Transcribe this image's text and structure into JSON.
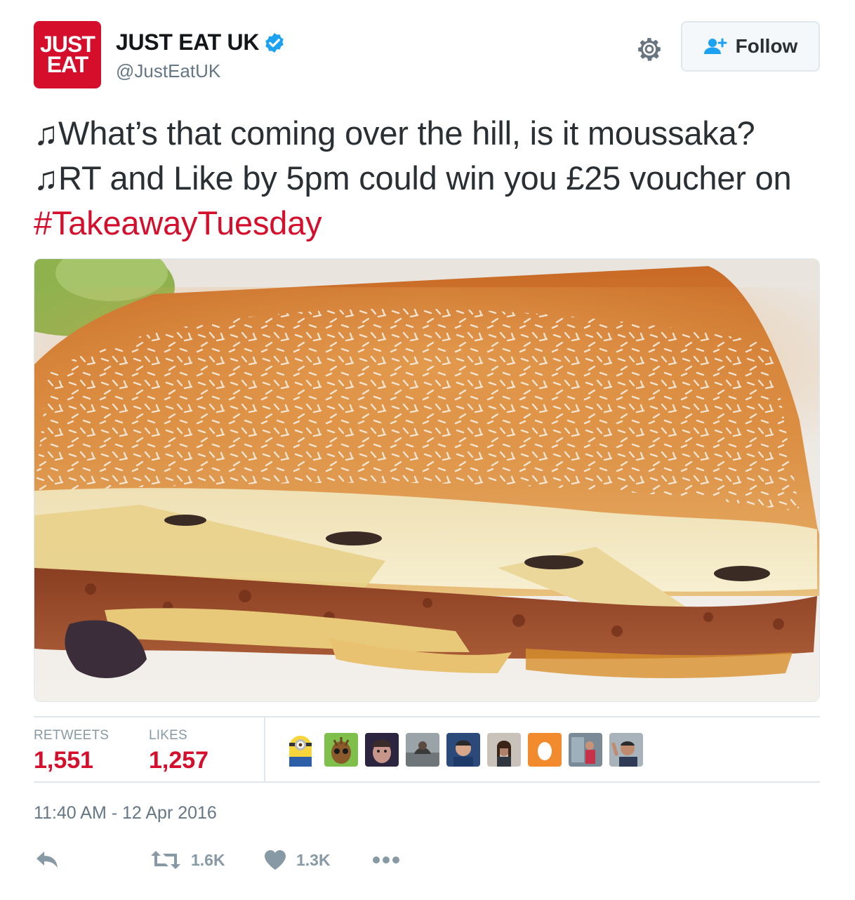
{
  "account": {
    "logo_line1": "JUST",
    "logo_line2": "EAT",
    "display_name": "JUST EAT UK",
    "handle": "@JustEatUK",
    "brand_color": "#d50e2c",
    "verified_color": "#1da1f2"
  },
  "header": {
    "settings_icon": "gear-icon",
    "follow_label": "Follow",
    "follow_icon": "add-person-icon"
  },
  "tweet": {
    "text_part1": "♫What’s that coming over the hill, is it moussaka? ♫RT and Like by 5pm could win you £25 voucher on ",
    "hashtag": "#TakeawayTuesday"
  },
  "stats": {
    "retweets_label": "RETWEETS",
    "retweets_value": "1,551",
    "likes_label": "LIKES",
    "likes_value": "1,257",
    "liker_avatars": [
      "minion-avatar",
      "groot-avatar",
      "user-avatar-3",
      "user-avatar-4",
      "user-avatar-5",
      "user-avatar-6",
      "egg-avatar",
      "user-avatar-8",
      "user-avatar-9"
    ]
  },
  "timestamp": "11:40 AM - 12 Apr 2016",
  "actions": {
    "reply_icon": "reply-icon",
    "retweet_icon": "retweet-icon",
    "retweet_count": "1.6K",
    "like_icon": "heart-icon",
    "like_count": "1.3K",
    "more_icon": "more-icon"
  }
}
